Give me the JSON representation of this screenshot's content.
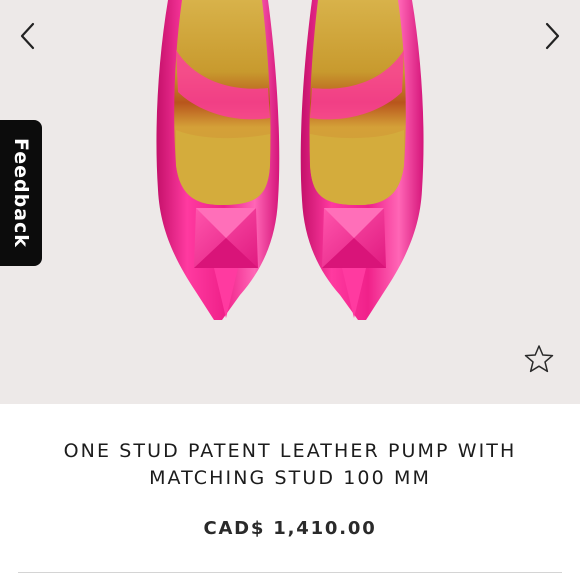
{
  "gallery": {
    "prev_icon": "chevron-left-icon",
    "next_icon": "chevron-right-icon",
    "wishlist_icon": "star-outline-icon",
    "image_alt": ""
  },
  "feedback": {
    "label": "Feedback"
  },
  "product": {
    "title": "ONE STUD PATENT LEATHER PUMP WITH MATCHING STUD 100 MM",
    "price": "CAD$ 1,410.00"
  },
  "colors": {
    "background": "#ede9e8",
    "shoe_pink": "#f0218a",
    "insole_gold": "#c8a233",
    "feedback_bg": "#0c0c0c",
    "text": "#1c1c1c"
  }
}
